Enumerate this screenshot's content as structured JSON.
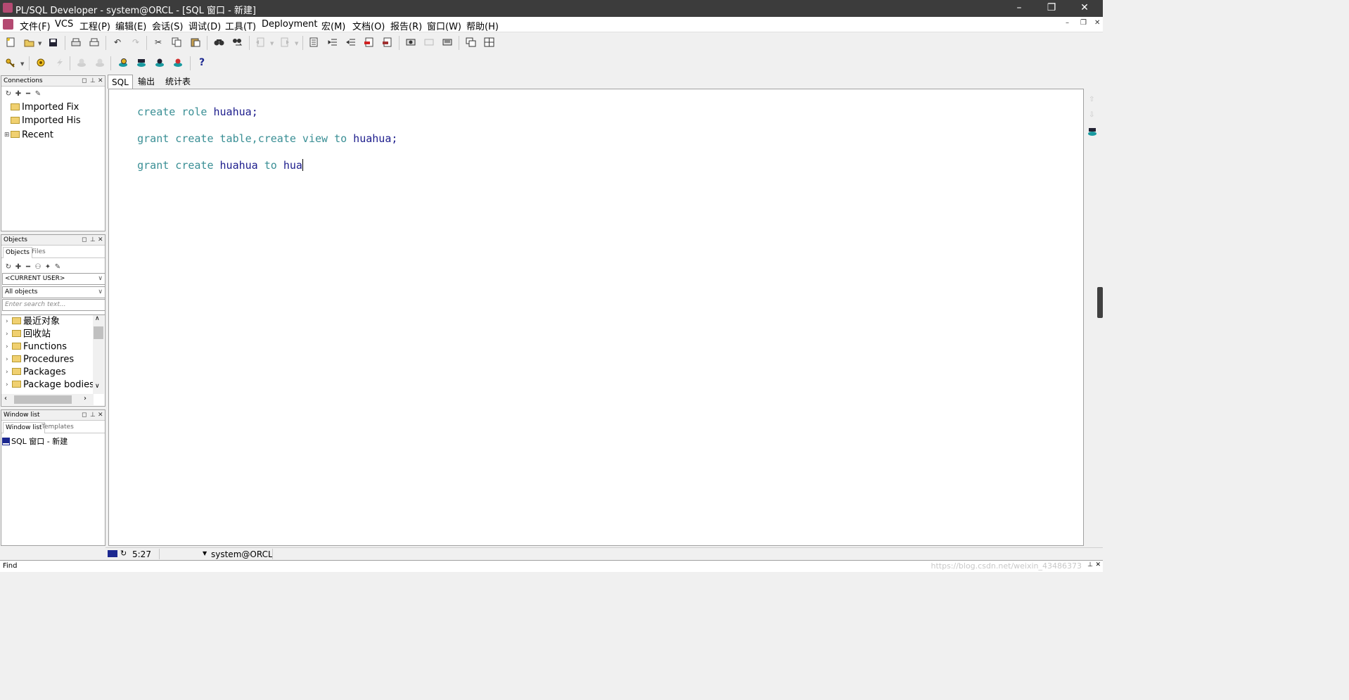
{
  "window": {
    "title": "PL/SQL Developer - system@ORCL - [SQL 窗口 - 新建]",
    "minimize": "–",
    "restore": "❐",
    "close": "✕"
  },
  "menubar": {
    "items": [
      "文件(F)",
      "VCS",
      "工程(P)",
      "编辑(E)",
      "会话(S)",
      "调试(D)",
      "工具(T)",
      "Deployment",
      "宏(M)",
      "文档(O)",
      "报告(R)",
      "窗口(W)",
      "帮助(H)"
    ],
    "mdi_minimize": "–",
    "mdi_restore": "❐",
    "mdi_close": "✕"
  },
  "toolbar2": {
    "help": "?"
  },
  "connections": {
    "title": "Connections",
    "items": [
      {
        "label": "Imported Fix",
        "expandable": false
      },
      {
        "label": "Imported His",
        "expandable": false
      },
      {
        "label": "Recent",
        "expandable": true
      }
    ]
  },
  "objects": {
    "title": "Objects",
    "tabs": [
      "Objects",
      "Files"
    ],
    "user_select": "<CURRENT USER>",
    "filter_select": "All objects",
    "search_placeholder": "Enter search text...",
    "tree": [
      "最近对象",
      "回收站",
      "Functions",
      "Procedures",
      "Packages",
      "Package bodies"
    ]
  },
  "window_list": {
    "title": "Window list",
    "tabs": [
      "Window list",
      "Templates"
    ],
    "items": [
      "SQL 窗口 - 新建"
    ]
  },
  "editor": {
    "tabs": [
      "SQL",
      "输出",
      "统计表"
    ],
    "lines": [
      [
        {
          "t": "create role ",
          "c": "kw"
        },
        {
          "t": "huahua",
          "c": "idf"
        },
        {
          "t": ";",
          "c": "idf"
        }
      ],
      [
        {
          "t": "grant create table,create view to ",
          "c": "kw"
        },
        {
          "t": "huahua",
          "c": "idf"
        },
        {
          "t": ";",
          "c": "idf"
        }
      ],
      [
        {
          "t": "grant create ",
          "c": "kw"
        },
        {
          "t": "huahua",
          "c": "idf"
        },
        {
          "t": " to ",
          "c": "kw"
        },
        {
          "t": "hua",
          "c": "idf"
        }
      ]
    ]
  },
  "status": {
    "position": "5:27",
    "connection": "system@ORCL"
  },
  "find": {
    "label": "Find"
  },
  "watermark": "https://blog.csdn.net/weixin_43486373"
}
